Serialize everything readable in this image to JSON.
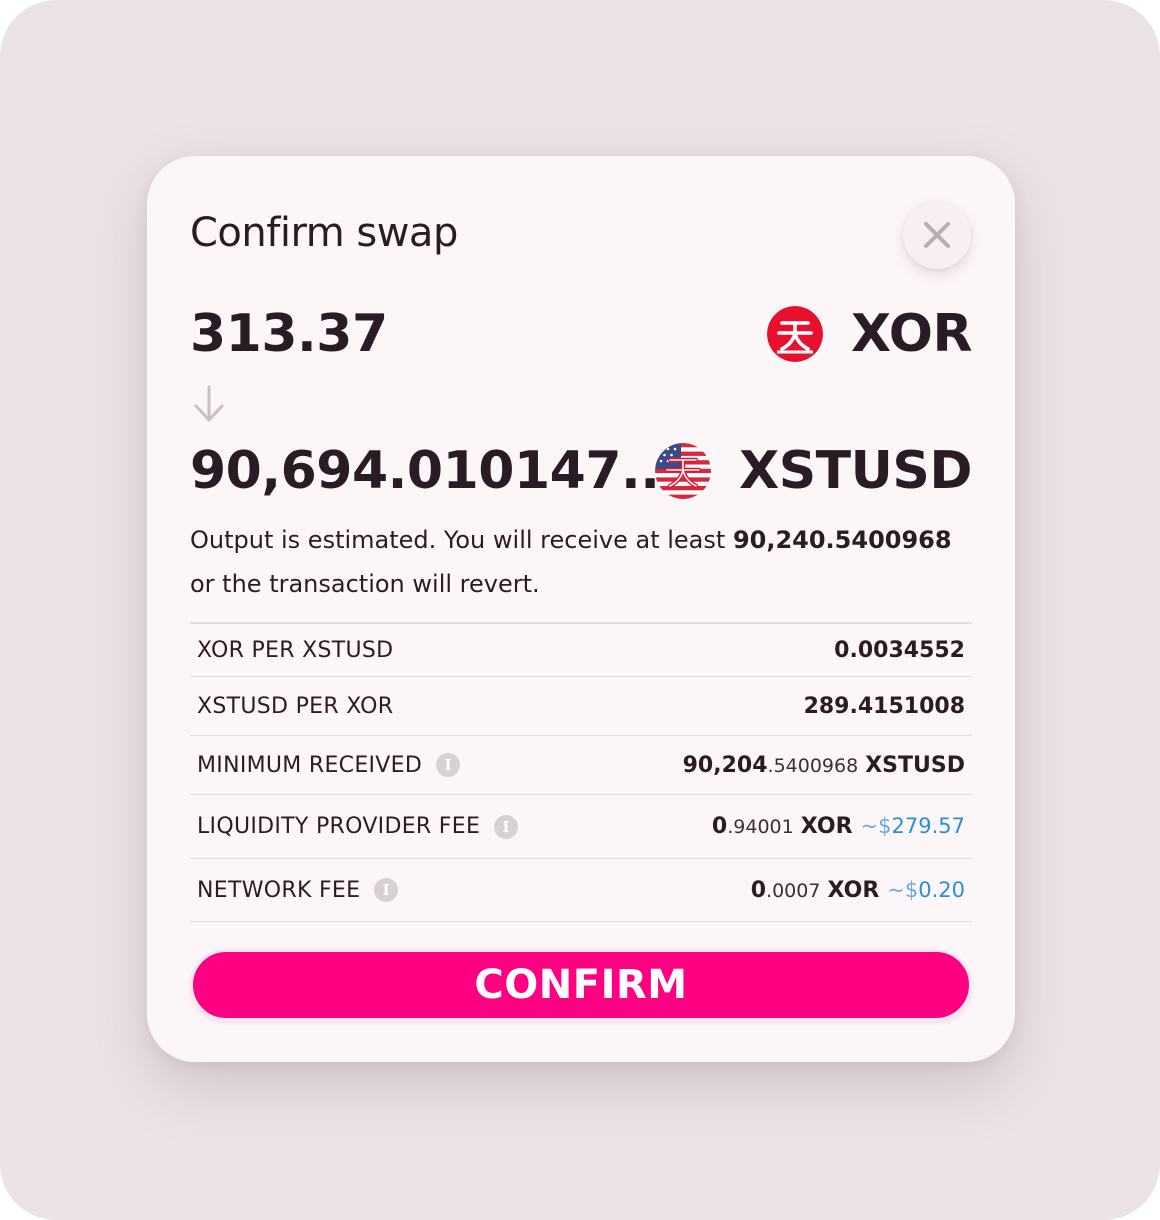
{
  "dialog": {
    "title": "Confirm swap",
    "close_label": "×"
  },
  "from": {
    "amount": "313.37",
    "symbol": "XOR",
    "icon": "xor-token-icon",
    "color": "#e8112d"
  },
  "to": {
    "amount": "90,694.010147...",
    "symbol": "XSTUSD",
    "icon": "xstusd-token-icon"
  },
  "note": {
    "prefix": "Output is estimated. You will receive at least",
    "min_amount": "90,240.5400968",
    "suffix": "or the transaction will revert."
  },
  "details": {
    "xor_per_xstusd": {
      "label": "XOR PER XSTUSD",
      "value": "0.0034552"
    },
    "xstusd_per_xor": {
      "label": "XSTUSD PER XOR",
      "value": "289.4151008"
    },
    "minimum_received": {
      "label": "MINIMUM RECEIVED",
      "value_int": "90,204",
      "value_frac": ".5400968",
      "symbol": "XSTUSD"
    },
    "liquidity_fee": {
      "label": "LIQUIDITY PROVIDER FEE",
      "value_int": "0",
      "value_frac": ".94001",
      "symbol": "XOR",
      "usd_prefix": "~$",
      "usd_value": "279.57"
    },
    "network_fee": {
      "label": "NETWORK FEE",
      "value_int": "0",
      "value_frac": ".0007",
      "symbol": "XOR",
      "usd_prefix": "~$",
      "usd_value": "0.20"
    }
  },
  "confirm_button": {
    "label": "CONFIRM",
    "color": "#ff0083"
  }
}
